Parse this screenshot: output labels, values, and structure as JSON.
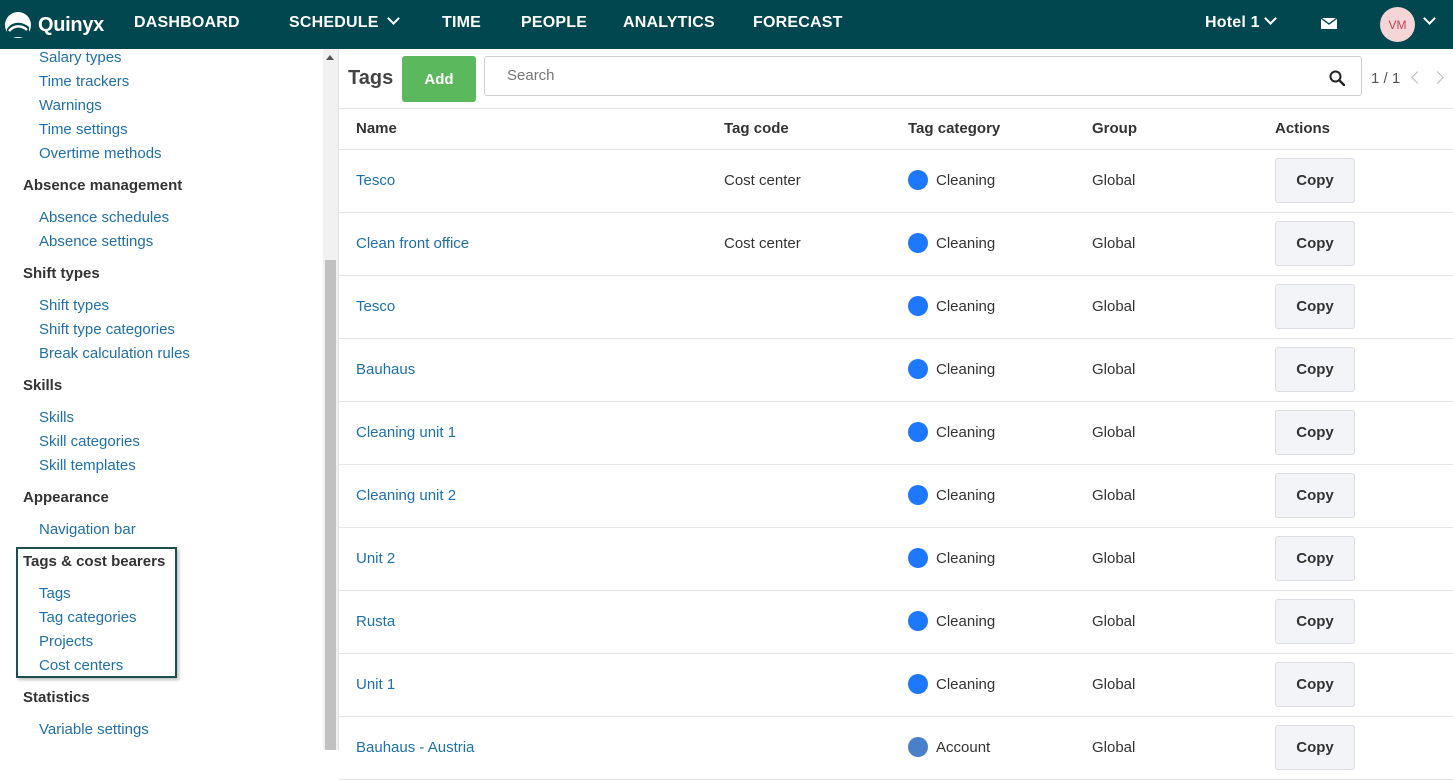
{
  "app": {
    "brand": "Quinyx"
  },
  "nav": {
    "items": [
      "DASHBOARD",
      "SCHEDULE",
      "TIME",
      "PEOPLE",
      "ANALYTICS",
      "FORECAST"
    ],
    "unit": "Hotel 1",
    "avatar_initials": "VM",
    "icons": {
      "mail": "mail-icon",
      "chevron": "chevron-down-icon"
    }
  },
  "sidebar": {
    "top_links": [
      "Salary types",
      "Time trackers",
      "Warnings",
      "Time settings",
      "Overtime methods"
    ],
    "groups": [
      {
        "title": "Absence management",
        "links": [
          "Absence schedules",
          "Absence settings"
        ]
      },
      {
        "title": "Shift types",
        "links": [
          "Shift types",
          "Shift type categories",
          "Break calculation rules"
        ]
      },
      {
        "title": "Skills",
        "links": [
          "Skills",
          "Skill categories",
          "Skill templates"
        ]
      },
      {
        "title": "Appearance",
        "links": [
          "Navigation bar"
        ]
      },
      {
        "title": "Tags & cost bearers",
        "links": [
          "Tags",
          "Tag categories",
          "Projects",
          "Cost centers"
        ]
      },
      {
        "title": "Statistics",
        "links": [
          "Variable settings"
        ]
      }
    ]
  },
  "main": {
    "title": "Tags",
    "add_label": "Add",
    "search_placeholder": "Search",
    "pager": "1 / 1",
    "columns": [
      "Name",
      "Tag code",
      "Tag category",
      "Group",
      "Actions"
    ],
    "rows": [
      {
        "name": "Tesco",
        "code": "Cost center",
        "category": "Cleaning",
        "color": "#1e78ff",
        "group": "Global",
        "action": "Copy"
      },
      {
        "name": "Clean front office",
        "code": "Cost center",
        "category": "Cleaning",
        "color": "#1e78ff",
        "group": "Global",
        "action": "Copy"
      },
      {
        "name": "Tesco",
        "code": "",
        "category": "Cleaning",
        "color": "#1e78ff",
        "group": "Global",
        "action": "Copy"
      },
      {
        "name": "Bauhaus",
        "code": "",
        "category": "Cleaning",
        "color": "#1e78ff",
        "group": "Global",
        "action": "Copy"
      },
      {
        "name": "Cleaning unit 1",
        "code": "",
        "category": "Cleaning",
        "color": "#1e78ff",
        "group": "Global",
        "action": "Copy"
      },
      {
        "name": "Cleaning unit 2",
        "code": "",
        "category": "Cleaning",
        "color": "#1e78ff",
        "group": "Global",
        "action": "Copy"
      },
      {
        "name": "Unit 2",
        "code": "",
        "category": "Cleaning",
        "color": "#1e78ff",
        "group": "Global",
        "action": "Copy"
      },
      {
        "name": "Rusta",
        "code": "",
        "category": "Cleaning",
        "color": "#1e78ff",
        "group": "Global",
        "action": "Copy"
      },
      {
        "name": "Unit 1",
        "code": "",
        "category": "Cleaning",
        "color": "#1e78ff",
        "group": "Global",
        "action": "Copy"
      },
      {
        "name": "Bauhaus - Austria",
        "code": "",
        "category": "Account",
        "color": "#4a7fc9",
        "group": "Global",
        "action": "Copy"
      }
    ]
  }
}
